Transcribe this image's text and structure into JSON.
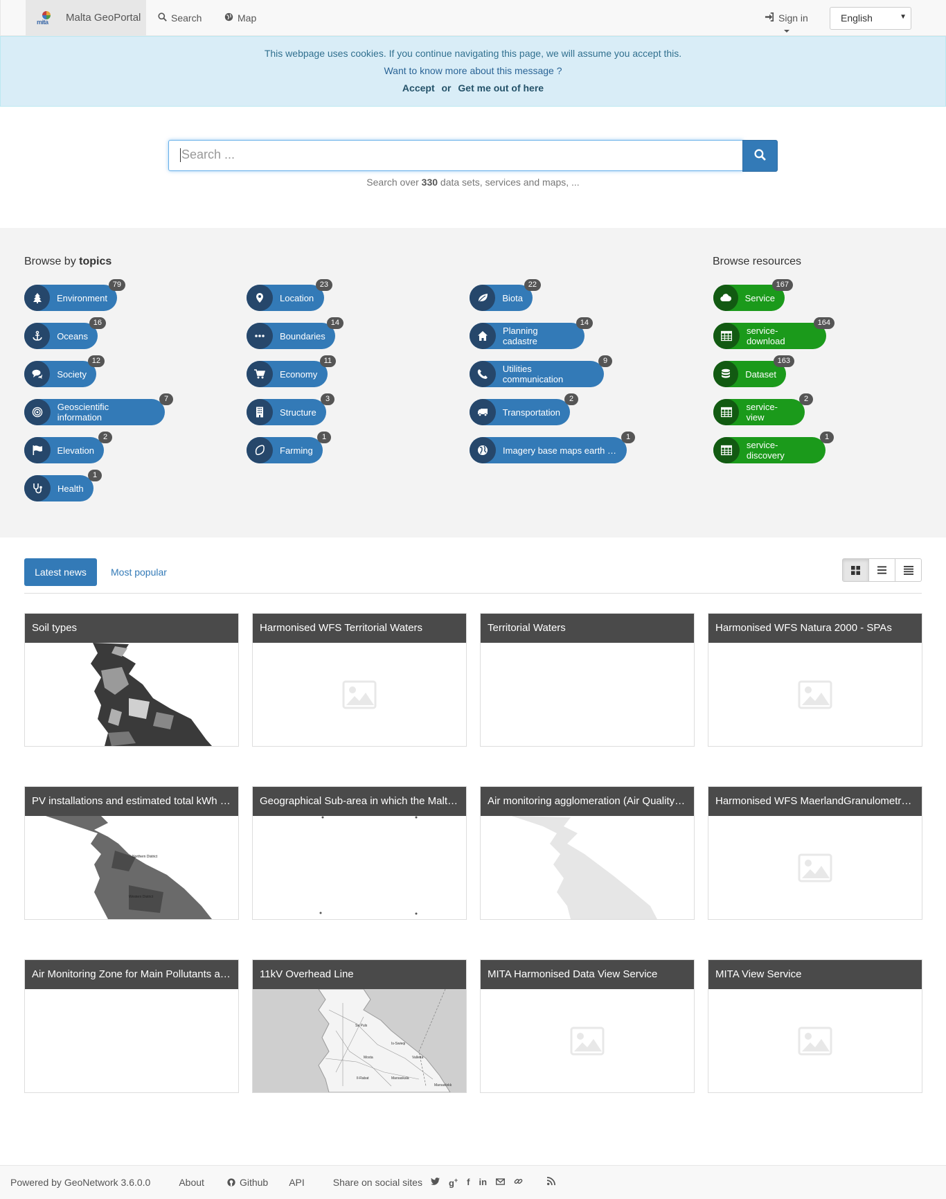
{
  "navbar": {
    "brand": "Malta GeoPortal",
    "brand_logo_text": "mita",
    "search": "Search",
    "map": "Map",
    "sign_in": "Sign in",
    "language": "English"
  },
  "cookie": {
    "line1": "This webpage uses cookies. If you continue navigating this page, we will assume you accept this.",
    "line2": "Want to know more about this message ?",
    "accept": "Accept",
    "or": "or",
    "leave": "Get me out of here"
  },
  "search": {
    "placeholder": "Search ...",
    "hint_prefix": "Search over",
    "hint_count": "330",
    "hint_suffix": "data sets, services and maps, ..."
  },
  "browse": {
    "topics_prefix": "Browse by",
    "topics_bold": "topics",
    "resources_title": "Browse resources",
    "topics": [
      {
        "label": "Environment",
        "count": "79",
        "icon": "tree-icon"
      },
      {
        "label": "Oceans",
        "count": "16",
        "icon": "anchor-icon"
      },
      {
        "label": "Society",
        "count": "12",
        "icon": "comments-icon"
      },
      {
        "label": "Geoscientific information",
        "count": "7",
        "icon": "bullseye-icon"
      },
      {
        "label": "Elevation",
        "count": "2",
        "icon": "flag-icon"
      },
      {
        "label": "Health",
        "count": "1",
        "icon": "stethoscope-icon"
      },
      {
        "label": "Location",
        "count": "23",
        "icon": "map-marker-icon"
      },
      {
        "label": "Boundaries",
        "count": "14",
        "icon": "ellipsis-icon"
      },
      {
        "label": "Economy",
        "count": "11",
        "icon": "cart-icon"
      },
      {
        "label": "Structure",
        "count": "3",
        "icon": "building-icon"
      },
      {
        "label": "Farming",
        "count": "1",
        "icon": "seed-icon"
      },
      {
        "label": "Biota",
        "count": "22",
        "icon": "leaf-icon"
      },
      {
        "label": "Planning cadastre",
        "count": "14",
        "icon": "home-icon"
      },
      {
        "label": "Utilities communication",
        "count": "9",
        "icon": "phone-icon"
      },
      {
        "label": "Transportation",
        "count": "2",
        "icon": "truck-icon"
      },
      {
        "label": "Imagery base maps earth …",
        "count": "1",
        "icon": "globe-icon"
      }
    ],
    "resources": [
      {
        "label": "Service",
        "count": "167",
        "icon": "cloud-icon"
      },
      {
        "label": "service-download",
        "count": "164",
        "icon": "table-icon"
      },
      {
        "label": "Dataset",
        "count": "163",
        "icon": "database-icon"
      },
      {
        "label": "service-view",
        "count": "2",
        "icon": "table-icon"
      },
      {
        "label": "service-discovery",
        "count": "1",
        "icon": "table-icon"
      }
    ]
  },
  "news": {
    "tab_latest": "Latest news",
    "tab_popular": "Most popular",
    "cards": [
      {
        "title": "Soil types",
        "thumb": "soil-map"
      },
      {
        "title": "Harmonised WFS Territorial Waters",
        "thumb": "placeholder"
      },
      {
        "title": "Territorial Waters",
        "thumb": "blank"
      },
      {
        "title": "Harmonised WFS Natura 2000 - SPAs",
        "thumb": "placeholder"
      },
      {
        "title": "PV installations and estimated total kWh …",
        "thumb": "pv-map"
      },
      {
        "title": "Geographical Sub-area in which the Malt…",
        "thumb": "dots"
      },
      {
        "title": "Air monitoring agglomeration (Air Quality…",
        "thumb": "faint-map"
      },
      {
        "title": "Harmonised WFS MaerlandGranulometr…",
        "thumb": "placeholder"
      },
      {
        "title": "Air Monitoring Zone for Main Pollutants a…",
        "thumb": "blank"
      },
      {
        "title": "11kV Overhead Line",
        "thumb": "road-map"
      },
      {
        "title": "MITA Harmonised Data View Service",
        "thumb": "placeholder"
      },
      {
        "title": "MITA View Service",
        "thumb": "placeholder"
      }
    ]
  },
  "footer": {
    "powered": "Powered by GeoNetwork 3.6.0.0",
    "about": "About",
    "github": "Github",
    "api": "API",
    "share": "Share on social sites"
  }
}
